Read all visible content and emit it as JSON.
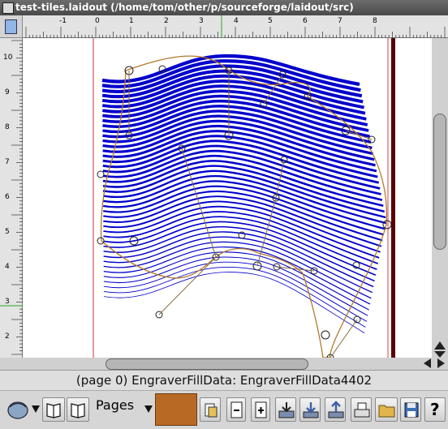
{
  "window": {
    "title": "test-tiles.laidout (/home/tom/other/p/sourceforge/laidout/src)"
  },
  "ruler": {
    "h_labels": [
      "-1",
      "0",
      "1",
      "2",
      "3",
      "4",
      "5",
      "6",
      "7",
      "8"
    ],
    "v_labels": [
      "10",
      "9",
      "8",
      "7",
      "6",
      "5",
      "4",
      "3",
      "2"
    ]
  },
  "status": {
    "text": "(page 0) EngraverFillData: EngraverFillData4402"
  },
  "toolbar": {
    "pages_label": "Pages",
    "color_swatch": "#b86a24",
    "buttons": [
      "spread-view-icon",
      "page-left-icon",
      "page-right-icon",
      "tool-icon",
      "minus-icon",
      "plus-icon",
      "import-icon",
      "download-icon",
      "upload-icon",
      "print-icon",
      "open-folder-icon",
      "save-icon",
      "help-icon"
    ],
    "help_label": "?"
  },
  "colors": {
    "fill_lines": "#0000cc",
    "outline": "#b4782a",
    "page_edge": "#5a0000",
    "margin": "#cc3333"
  }
}
